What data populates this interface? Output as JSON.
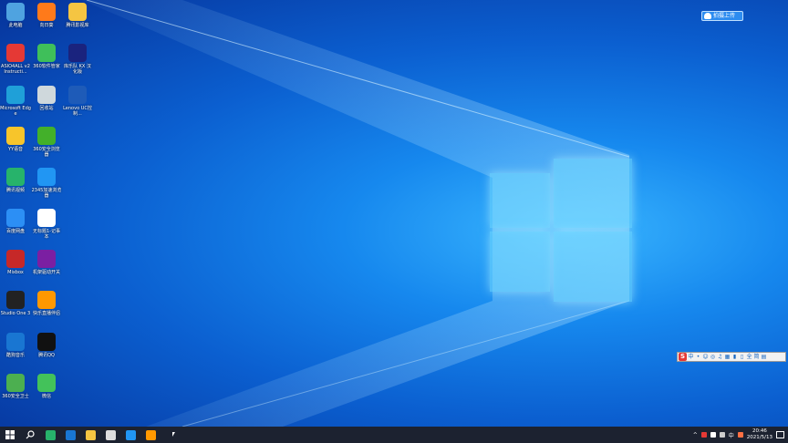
{
  "desktop_icons": [
    {
      "label": "此电脑",
      "icon": "computer-icon",
      "color": "#4fa3e0"
    },
    {
      "label": "向日葵",
      "icon": "sunflower-icon",
      "color": "#ff7a1a"
    },
    {
      "label": "腾讯影视库",
      "icon": "folder-icon",
      "color": "#f5c542"
    },
    {
      "label": "ASIO4ALL v2 Instructi...",
      "icon": "pdf-icon",
      "color": "#e53935"
    },
    {
      "label": "360软件管家",
      "icon": "software-manager-icon",
      "color": "#3fbf5a"
    },
    {
      "label": "库乐队 KX 汉化版",
      "icon": "kx-icon",
      "color": "#1a237e"
    },
    {
      "label": "Microsoft Edge",
      "icon": "edge-icon",
      "color": "#1fa0d8"
    },
    {
      "label": "回收站",
      "icon": "recycle-bin-icon",
      "color": "#cfd8dc"
    },
    {
      "label": "Lenovo UC控制...",
      "icon": "bb-icon",
      "color": "#1e5bb8"
    },
    {
      "label": "YY语音",
      "icon": "yy-icon",
      "color": "#f7c52b"
    },
    {
      "label": "360安全浏览器",
      "icon": "browser-360-icon",
      "color": "#43b02a"
    },
    {
      "label": "腾讯视频",
      "icon": "tencent-video-icon",
      "color": "#27b36b"
    },
    {
      "label": "2345加速浏览器",
      "icon": "ie-browser-icon",
      "color": "#2196f3"
    },
    {
      "label": "百度网盘",
      "icon": "baidu-pan-icon",
      "color": "#2c8ff5"
    },
    {
      "label": "无标题1-记事本",
      "icon": "document-icon",
      "color": "#ffffff"
    },
    {
      "label": "Mixbox",
      "icon": "mixbox-icon",
      "color": "#c62828"
    },
    {
      "label": "机架驱动开关",
      "icon": "piano-icon",
      "color": "#7b1fa2"
    },
    {
      "label": "Studio One 3",
      "icon": "studio-one-icon",
      "color": "#222222"
    },
    {
      "label": "快乐直播伴侣",
      "icon": "live-companion-icon",
      "color": "#ff9800"
    },
    {
      "label": "酷狗音乐",
      "icon": "kugou-icon",
      "color": "#1976d2"
    },
    {
      "label": "腾讯QQ",
      "icon": "qq-icon",
      "color": "#111111"
    },
    {
      "label": "360安全卫士",
      "icon": "shield-360-icon",
      "color": "#4caf50"
    },
    {
      "label": "微信",
      "icon": "wechat-icon",
      "color": "#43c25a"
    }
  ],
  "upload_button": {
    "label": "拍摄上传",
    "icon": "cloud-icon"
  },
  "ime_bar": {
    "logo": "S",
    "items": [
      "中",
      "•",
      "☺",
      "◎",
      "♫",
      "▦",
      "▮",
      "▯",
      "全",
      "简",
      "▤"
    ]
  },
  "taskbar": {
    "apps": [
      {
        "name": "search-icon",
        "color": "#ffffff"
      },
      {
        "name": "tencent-video-taskbar-icon",
        "color": "#27b36b"
      },
      {
        "name": "kugou-taskbar-icon",
        "color": "#1976d2"
      },
      {
        "name": "file-explorer-taskbar-icon",
        "color": "#f5c542"
      },
      {
        "name": "studio-one-taskbar-icon",
        "color": "#dddddd"
      },
      {
        "name": "ie-taskbar-icon",
        "color": "#2196f3"
      },
      {
        "name": "live-companion-taskbar-icon",
        "color": "#ff9800"
      }
    ],
    "tray": {
      "ime_label": "中",
      "time": "20:46",
      "date": "2021/5/13"
    }
  },
  "colors": {
    "taskbar": "#1c2230",
    "accent": "#2d8cf0"
  }
}
